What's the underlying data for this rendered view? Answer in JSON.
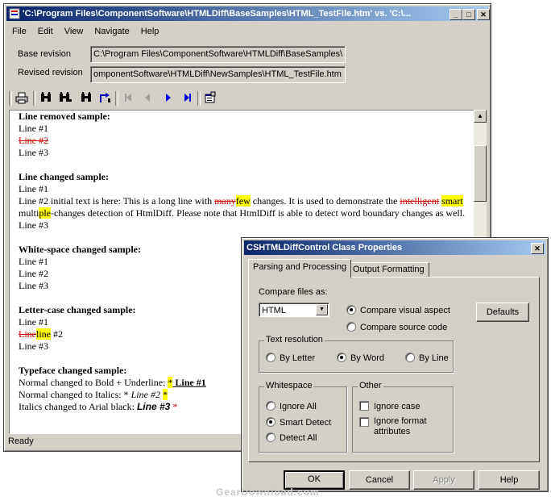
{
  "main_window": {
    "title": "'C:\\Program Files\\ComponentSoftware\\HTMLDiff\\BaseSamples\\HTML_TestFile.htm' vs. 'C:\\...",
    "minimize_glyph": "_",
    "maximize_glyph": "□",
    "close_glyph": "✕"
  },
  "menu": {
    "file": "File",
    "edit": "Edit",
    "view": "View",
    "navigate": "Navigate",
    "help": "Help"
  },
  "revisions": {
    "base_label": "Base revision",
    "base_value": "C:\\Program Files\\ComponentSoftware\\HTMLDiff\\BaseSamples\\",
    "revised_label": "Revised revision",
    "revised_value": "omponentSoftware\\HTMLDiff\\NewSamples\\HTML_TestFile.htm"
  },
  "toolbar_icons": [
    "print-icon",
    "find-icon",
    "find-next-icon",
    "find-prev-icon",
    "goto-next-icon",
    "first-change-icon",
    "prev-change-icon",
    "next-change-icon",
    "last-change-icon",
    "properties-icon"
  ],
  "document": {
    "s1_title": "Line removed sample:",
    "s1_l1": "Line #1",
    "s1_l2_removed": "Line #2",
    "s1_l3": "Line #3",
    "s2_title": "Line changed sample:",
    "s2_l1": "Line #1",
    "s2_l2_a": "Line #2 initial text is here: This is a long line with ",
    "s2_l2_del1": "many",
    "s2_l2_ins1": "few",
    "s2_l2_b": " changes. It is used to demonstrate the ",
    "s2_l2_del2": "intelligent",
    "s2_l2_ins2": "smart",
    "s2_l2_c": " multi",
    "s2_l2_ins3": "ple",
    "s2_l2_d": "-changes detection of HtmlDiff. Please note that HtmlDiff is able to detect word boundary changes as well.",
    "s2_l3": "Line #3",
    "s3_title": "White-space changed sample:",
    "s3_l1": "Line #1",
    "s3_l2": "Line #2",
    "s3_l3": "Line #3",
    "s4_title": "Letter-case changed sample:",
    "s4_l1": "Line #1",
    "s4_l2_del": "Line",
    "s4_l2_ins": "line",
    "s4_l2_rest": " #2",
    "s4_l3": "Line #3",
    "s5_title": "Typeface changed sample:",
    "s5_l1_a": "Normal changed to Bold + Underline: ",
    "s5_l1_star": "*",
    "s5_l1_b": " Line #1",
    "s5_l2_a": "Normal changed to Italics: * ",
    "s5_l2_b": "Line #2",
    "s5_l2_star": "*",
    "s5_l3_a": "Italics changed to Arial black: ",
    "s5_l3_b": "Line #3",
    "s5_l3_star": "*"
  },
  "status": {
    "text": "Ready"
  },
  "dialog": {
    "title": "CSHTMLDiffControl Class Properties",
    "close_glyph": "✕",
    "tab1": "Parsing and Processing",
    "tab2": "Output Formatting",
    "compare_label": "Compare files as:",
    "compare_value": "HTML",
    "visual_aspect": "Compare visual aspect",
    "source_code": "Compare source code",
    "defaults": "Defaults",
    "text_resolution": "Text resolution",
    "by_letter": "By Letter",
    "by_word": "By Word",
    "by_line": "By Line",
    "whitespace": "Whitespace",
    "ignore_all": "Ignore All",
    "smart_detect": "Smart Detect",
    "detect_all": "Detect All",
    "other": "Other",
    "ignore_case": "Ignore case",
    "ignore_format": "Ignore format attributes",
    "ok": "OK",
    "cancel": "Cancel",
    "apply": "Apply",
    "help": "Help"
  },
  "watermark": "GearDownload.com"
}
